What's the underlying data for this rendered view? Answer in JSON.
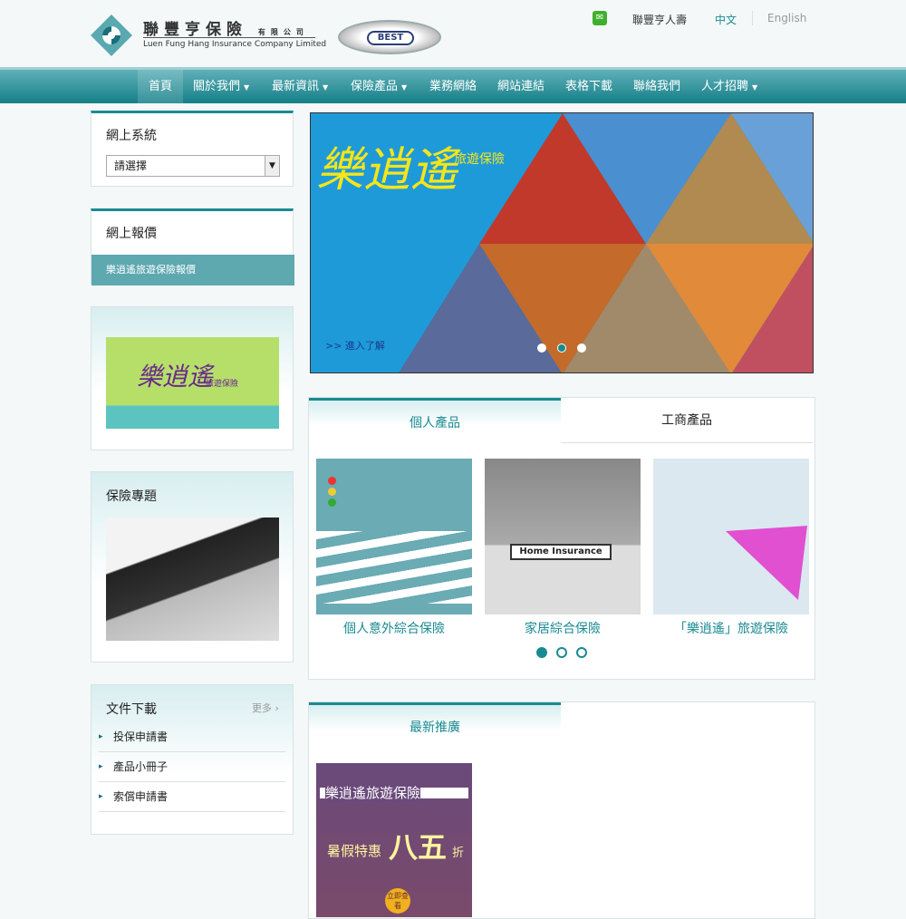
{
  "header": {
    "company_cn": "聯豐亨保險",
    "company_cn_suffix": "有限公司",
    "company_en": "Luen Fung Hang Insurance Company Limited",
    "rating_badge": "BEST",
    "links": {
      "life": "聯豐亨人壽",
      "chinese": "中文",
      "english": "English"
    }
  },
  "nav": {
    "items": [
      {
        "label": "首頁",
        "dropdown": false
      },
      {
        "label": "關於我們",
        "dropdown": true
      },
      {
        "label": "最新資訊",
        "dropdown": true
      },
      {
        "label": "保險產品",
        "dropdown": true
      },
      {
        "label": "業務網絡",
        "dropdown": false
      },
      {
        "label": "網站連結",
        "dropdown": false
      },
      {
        "label": "表格下載",
        "dropdown": false
      },
      {
        "label": "聯絡我們",
        "dropdown": false
      },
      {
        "label": "人才招聘",
        "dropdown": true
      }
    ]
  },
  "sidebar": {
    "online_system": {
      "title": "網上系統",
      "select_value": "請選擇"
    },
    "online_quote": {
      "title": "網上報價",
      "link": "樂逍遙旅遊保險報價"
    },
    "banner_small": {
      "text": "樂逍遙",
      "subtext": "旅遊保險"
    },
    "topics": {
      "title": "保險專題"
    },
    "downloads": {
      "title": "文件下載",
      "more": "更多",
      "items": [
        "投保申請書",
        "產品小冊子",
        "索償申請書"
      ]
    }
  },
  "hero": {
    "script_text": "樂逍遙",
    "subtitle": "旅遊保險",
    "link": ">> 進入了解",
    "slides": 3,
    "active_slide": 1
  },
  "products": {
    "tabs": [
      "個人產品",
      "工商產品"
    ],
    "active_tab": 0,
    "items": [
      "個人意外綜合保險",
      "家居綜合保險",
      "「樂逍遙」旅遊保險"
    ],
    "home_sign": "Home Insurance",
    "pages": 3,
    "active_page": 0
  },
  "promo": {
    "title": "最新推廣",
    "banner_title": "樂逍遙旅遊保險",
    "banner_offer": "暑假特惠",
    "banner_discount": "八五",
    "banner_suffix": "折",
    "banner_button": "立即查看"
  },
  "colors": {
    "accent": "#1a8a92",
    "nav_top": "#5fb0b8",
    "nav_bottom": "#157f88"
  }
}
